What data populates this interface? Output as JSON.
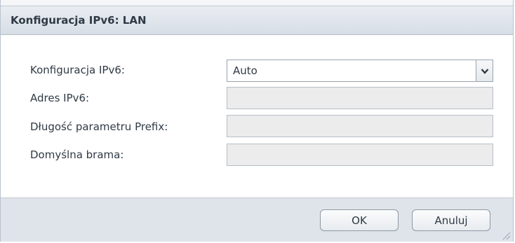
{
  "dialog": {
    "title": "Konfiguracja IPv6: LAN"
  },
  "form": {
    "ipv6_config": {
      "label": "Konfiguracja IPv6:",
      "value": "Auto"
    },
    "ipv6_address": {
      "label": "Adres IPv6:",
      "value": ""
    },
    "prefix_length": {
      "label": "Długość parametru Prefix:",
      "value": ""
    },
    "default_gateway": {
      "label": "Domyślna brama:",
      "value": ""
    }
  },
  "buttons": {
    "ok_label": "OK",
    "cancel_label": "Anuluj"
  },
  "icons": {
    "dropdown": "chevron-down-icon",
    "resize": "resize-grip-icon"
  },
  "colors": {
    "title_bar": "#dde3ea",
    "footer": "#dfe4ea",
    "disabled_field": "#ececec",
    "text": "#2f3a45"
  }
}
